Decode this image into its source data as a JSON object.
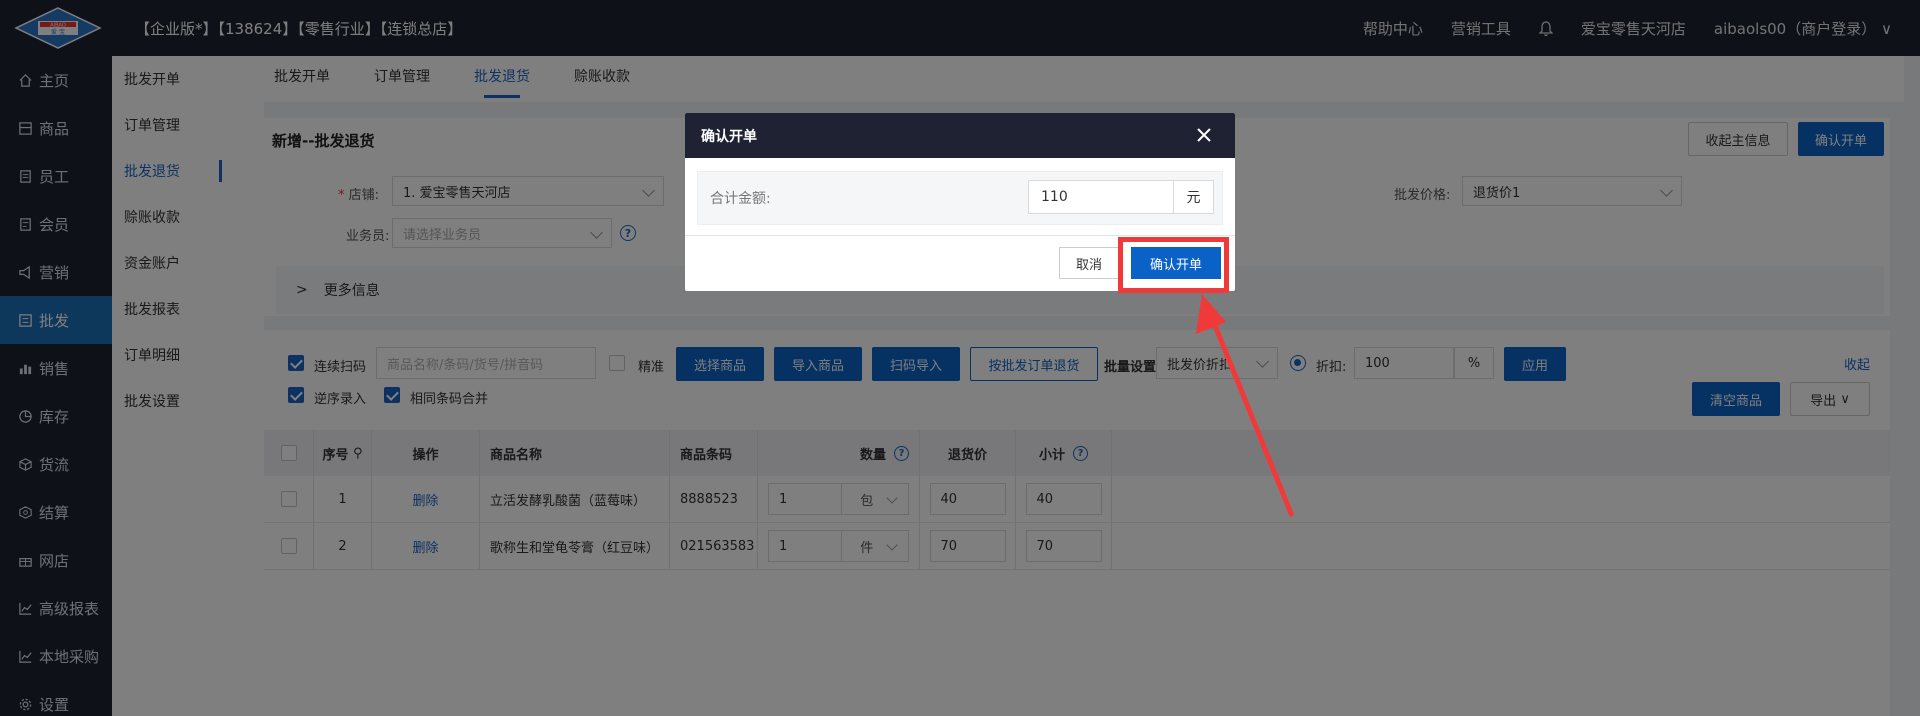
{
  "header": {
    "title": "【企业版*】【138624】【零售行业】【连锁总店】",
    "logo_text": "AIBAO 爱宝",
    "links": [
      "帮助中心",
      "营销工具"
    ],
    "store": "爱宝零售天河店",
    "user": "aibaols00（商户登录）"
  },
  "sidebar": {
    "items": [
      {
        "label": "主页",
        "icon": "home-icon"
      },
      {
        "label": "商品",
        "icon": "goods-icon"
      },
      {
        "label": "员工",
        "icon": "staff-icon"
      },
      {
        "label": "会员",
        "icon": "member-icon"
      },
      {
        "label": "营销",
        "icon": "megaphone-icon"
      },
      {
        "label": "批发",
        "icon": "wholesale-icon"
      },
      {
        "label": "销售",
        "icon": "bar-chart-icon"
      },
      {
        "label": "库存",
        "icon": "pie-icon"
      },
      {
        "label": "货流",
        "icon": "cube-icon"
      },
      {
        "label": "结算",
        "icon": "settle-icon"
      },
      {
        "label": "网店",
        "icon": "gift-icon"
      },
      {
        "label": "高级报表",
        "icon": "line-chart-icon"
      },
      {
        "label": "本地采购",
        "icon": "line-chart-icon"
      },
      {
        "label": "设置",
        "icon": "gear-icon"
      }
    ],
    "active_index": 5
  },
  "submenu": {
    "items": [
      "批发开单",
      "订单管理",
      "批发退货",
      "赊账收款",
      "资金账户",
      "批发报表",
      "订单明细",
      "批发设置"
    ],
    "active_index": 2
  },
  "tabs": {
    "items": [
      "批发开单",
      "订单管理",
      "批发退货",
      "赊账收款"
    ],
    "active_index": 2
  },
  "form": {
    "title": "新增--批发退货",
    "collapse_btn": "收起主信息",
    "confirm_btn": "确认开单",
    "store_label": "店铺:",
    "store_value": "1. 爱宝零售天河店",
    "salesman_label": "业务员:",
    "salesman_placeholder": "请选择业务员",
    "price_label": "批发价格:",
    "price_value": "退货价1",
    "more_info": "更多信息"
  },
  "toolbar": {
    "continuous_scan": "连续扫码",
    "search_placeholder": "商品名称/条码/货号/拼音码",
    "exact": "精准",
    "select_goods": "选择商品",
    "import_goods": "导入商品",
    "scan_import": "扫码导入",
    "return_by_order": "按批发订单退货",
    "batch_setting": "批量设置",
    "batch_value": "批发价折扣",
    "discount_label": "折扣:",
    "discount_value": "100",
    "percent": "%",
    "apply": "应用",
    "collapse": "收起",
    "reverse_entry": "逆序录入",
    "merge_same": "相同条码合并",
    "clear_goods": "清空商品",
    "export": "导出"
  },
  "table": {
    "headers": {
      "no": "序号",
      "op": "操作",
      "name": "商品名称",
      "code": "商品条码",
      "qty": "数量",
      "price": "退货价",
      "subtotal": "小计"
    },
    "rows": [
      {
        "no": "1",
        "op": "删除",
        "name": "立活发酵乳酸菌（蓝莓味）",
        "code": "8888523",
        "qty": "1",
        "unit": "包",
        "price": "40",
        "subtotal": "40"
      },
      {
        "no": "2",
        "op": "删除",
        "name": "歌称生和堂龟苓膏（红豆味）",
        "code": "021563583",
        "qty": "1",
        "unit": "件",
        "price": "70",
        "subtotal": "70"
      }
    ]
  },
  "modal": {
    "title": "确认开单",
    "total_label": "合计金额:",
    "total_value": "110",
    "unit": "元",
    "cancel": "取消",
    "confirm": "确认开单"
  },
  "colors": {
    "primary": "#0a62c7",
    "dark": "#1f2233",
    "highlight": "#f03a3a"
  }
}
